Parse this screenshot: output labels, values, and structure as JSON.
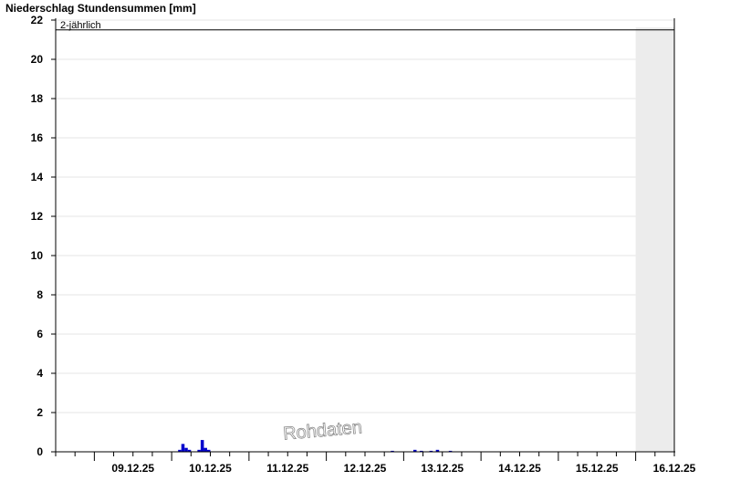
{
  "chart_data": {
    "type": "bar",
    "title": "Niederschlag Stundensummen [mm]",
    "xlabel": "",
    "ylabel": "",
    "ylim": [
      0,
      22
    ],
    "yticks": [
      0,
      2,
      4,
      6,
      8,
      10,
      12,
      14,
      16,
      18,
      20,
      22
    ],
    "x_start": "08.12.25 12:00",
    "x_end": "16.12.25 12:00",
    "xtick_labels": [
      "09.12.25",
      "10.12.25",
      "11.12.25",
      "12.12.25",
      "13.12.25",
      "14.12.25",
      "15.12.25",
      "16.12.25"
    ],
    "grid": true,
    "reference_line": {
      "label": "2-jährlich",
      "value": 21.5
    },
    "forecast_region_start": "16.12.25 00:00",
    "watermark": "Rohdaten",
    "bar_color": "#0000cc",
    "series": [
      {
        "x": [
          "10.12.25 02:00",
          "10.12.25 03:00",
          "10.12.25 04:00",
          "10.12.25 05:00",
          "10.12.25 08:00",
          "10.12.25 09:00",
          "10.12.25 10:00",
          "10.12.25 11:00",
          "12.12.25 20:00",
          "13.12.25 03:00",
          "13.12.25 05:00",
          "13.12.25 08:00",
          "13.12.25 10:00",
          "13.12.25 14:00"
        ],
        "values": [
          0.1,
          0.4,
          0.2,
          0.1,
          0.1,
          0.6,
          0.2,
          0.1,
          0.05,
          0.1,
          0.05,
          0.05,
          0.1,
          0.05
        ]
      }
    ]
  }
}
